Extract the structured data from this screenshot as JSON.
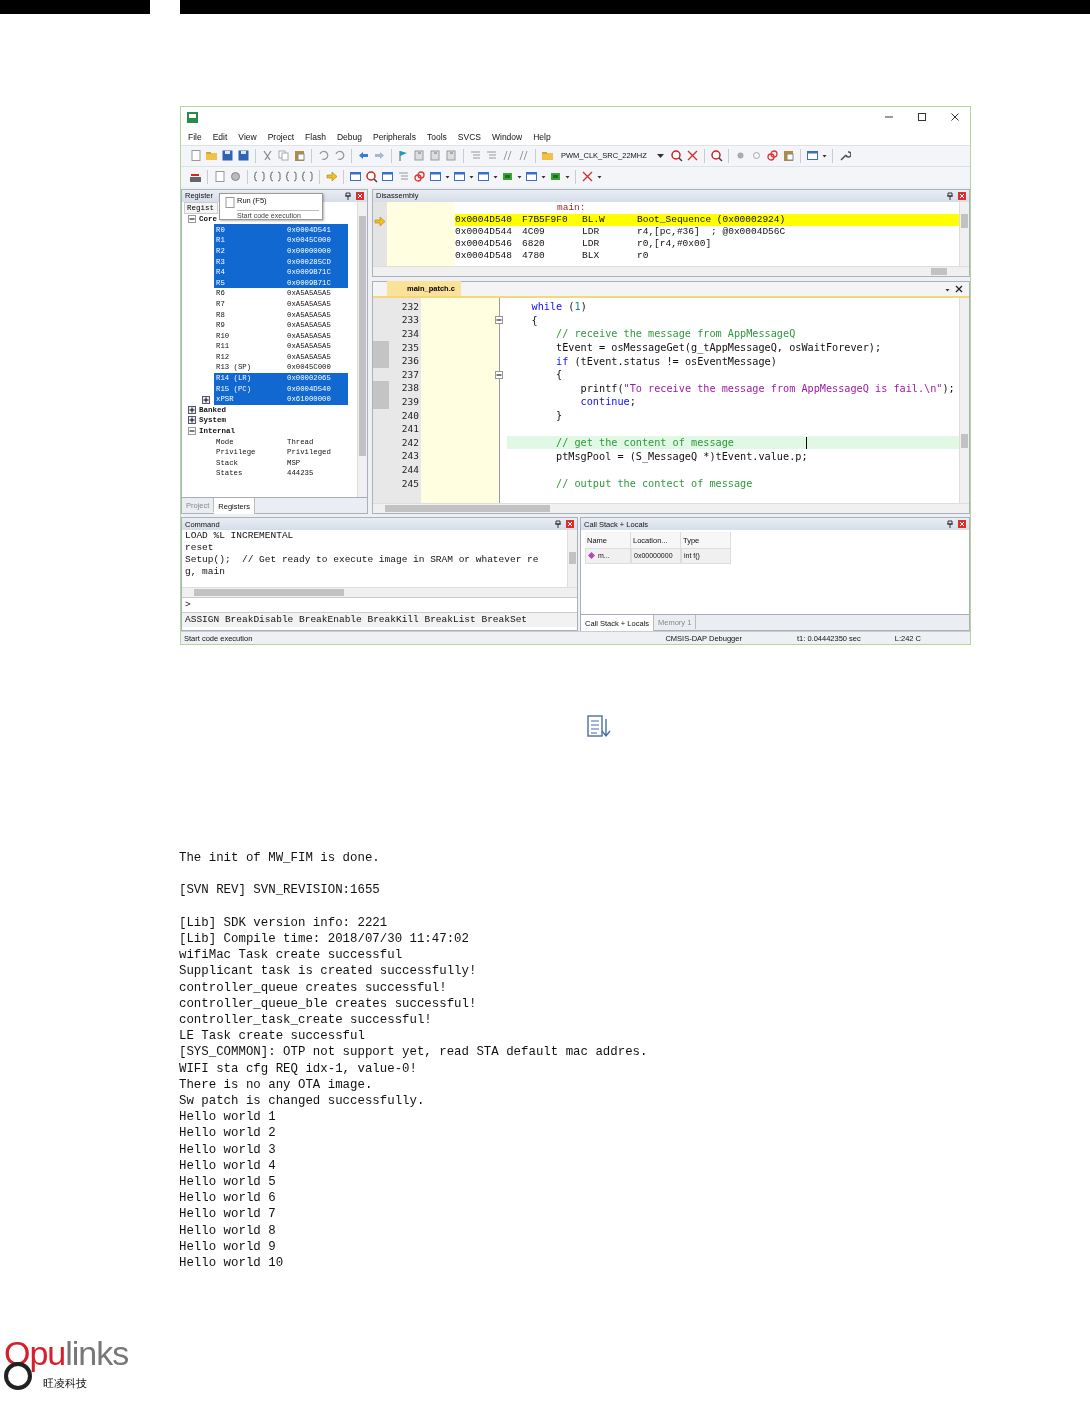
{
  "ide": {
    "menu": [
      "File",
      "Edit",
      "View",
      "Project",
      "Flash",
      "Debug",
      "Peripherals",
      "Tools",
      "SVCS",
      "Window",
      "Help"
    ],
    "toolbar": {
      "target": "PWM_CLK_SRC_22MHZ"
    },
    "registers": {
      "title": "Register",
      "tooltip": {
        "title": "Run (F5)",
        "hint": "Start code execution"
      },
      "column": "Regist",
      "tree": [
        {
          "label": "Core",
          "expanded": true,
          "children": [
            {
              "name": "R0",
              "value": "0x0004D541",
              "selected": true
            },
            {
              "name": "R1",
              "value": "0x0045C000",
              "selected": true
            },
            {
              "name": "R2",
              "value": "0x00000000",
              "selected": true
            },
            {
              "name": "R3",
              "value": "0x000285CD",
              "selected": true
            },
            {
              "name": "R4",
              "value": "0x0009B71C",
              "selected": true
            },
            {
              "name": "R5",
              "value": "0x0009B71C",
              "selected": true
            },
            {
              "name": "R6",
              "value": "0xA5A5A5A5",
              "selected": false
            },
            {
              "name": "R7",
              "value": "0xA5A5A5A5",
              "selected": false
            },
            {
              "name": "R8",
              "value": "0xA5A5A5A5",
              "selected": false
            },
            {
              "name": "R9",
              "value": "0xA5A5A5A5",
              "selected": false
            },
            {
              "name": "R10",
              "value": "0xA5A5A5A5",
              "selected": false
            },
            {
              "name": "R11",
              "value": "0xA5A5A5A5",
              "selected": false
            },
            {
              "name": "R12",
              "value": "0xA5A5A5A5",
              "selected": false
            },
            {
              "name": "R13 (SP)",
              "value": "0x0045C000",
              "selected": false
            },
            {
              "name": "R14 (LR)",
              "value": "0x00002065",
              "selected": true
            },
            {
              "name": "R15 (PC)",
              "value": "0x0004D540",
              "selected": true
            },
            {
              "name": "xPSR",
              "value": "0x61000000",
              "selected": true,
              "expanded": false
            }
          ]
        },
        {
          "label": "Banked",
          "expanded": false
        },
        {
          "label": "System",
          "expanded": false
        },
        {
          "label": "Internal",
          "expanded": true,
          "children": [
            {
              "name": "Mode",
              "value": "Thread",
              "selected": false
            },
            {
              "name": "Privilege",
              "value": "Privileged",
              "selected": false
            },
            {
              "name": "Stack",
              "value": "MSP",
              "selected": false
            },
            {
              "name": "States",
              "value": "444235",
              "selected": false
            }
          ]
        }
      ],
      "tabs": [
        {
          "label": "Project",
          "selected": false
        },
        {
          "label": "Registers",
          "selected": true
        }
      ]
    },
    "disassembly": {
      "title": "Disassembly",
      "label": "main:",
      "rows": [
        {
          "address": "0x0004D540",
          "opcode": "F7B5F9F0",
          "mnemonic": "BL.W",
          "operand": "Boot_Sequence (0x00002924)",
          "current": true
        },
        {
          "address": "0x0004D544",
          "opcode": "4C09",
          "mnemonic": "LDR",
          "operand": "r4,[pc,#36]  ; @0x0004D56C",
          "current": false
        },
        {
          "address": "0x0004D546",
          "opcode": "6820",
          "mnemonic": "LDR",
          "operand": "r0,[r4,#0x00]",
          "current": false
        },
        {
          "address": "0x0004D548",
          "opcode": "4780",
          "mnemonic": "BLX",
          "operand": "r0",
          "current": false
        }
      ]
    },
    "editor": {
      "tab": "main_patch.c",
      "lines": [
        {
          "number": "232",
          "segments": [
            {
              "kind": "keyword",
              "text": "    while"
            },
            {
              "kind": "plain",
              "text": " ("
            },
            {
              "kind": "number",
              "text": "1"
            },
            {
              "kind": "plain",
              "text": ")"
            }
          ]
        },
        {
          "number": "233",
          "fold": true,
          "segments": [
            {
              "kind": "plain",
              "text": "    {"
            }
          ]
        },
        {
          "number": "234",
          "segments": [
            {
              "kind": "comment",
              "text": "        // receive the message from AppMessageQ"
            }
          ]
        },
        {
          "number": "235",
          "marked": true,
          "segments": [
            {
              "kind": "plain",
              "text": "        tEvent = osMessageGet(g_tAppMessageQ, osWaitForever);"
            }
          ]
        },
        {
          "number": "236",
          "marked": true,
          "segments": [
            {
              "kind": "keyword",
              "text": "        if"
            },
            {
              "kind": "plain",
              "text": " (tEvent.status != osEventMessage)"
            }
          ]
        },
        {
          "number": "237",
          "fold": true,
          "segments": [
            {
              "kind": "plain",
              "text": "        {"
            }
          ]
        },
        {
          "number": "238",
          "marked": true,
          "segments": [
            {
              "kind": "plain",
              "text": "            printf("
            },
            {
              "kind": "string",
              "text": "\"To receive the message from AppMessageQ is fail.\\n\""
            },
            {
              "kind": "plain",
              "text": ");"
            }
          ]
        },
        {
          "number": "239",
          "marked": true,
          "segments": [
            {
              "kind": "keyword",
              "text": "            continue"
            },
            {
              "kind": "plain",
              "text": ";"
            }
          ]
        },
        {
          "number": "240",
          "segments": [
            {
              "kind": "plain",
              "text": "        }"
            }
          ]
        },
        {
          "number": "241"
        },
        {
          "number": "242",
          "highlighted": true,
          "segments": [
            {
              "kind": "comment",
              "text": "        // get the content of message"
            }
          ]
        },
        {
          "number": "243",
          "segments": [
            {
              "kind": "plain",
              "text": "        ptMsgPool = (S_MessageQ *)tEvent.value.p;"
            }
          ]
        },
        {
          "number": "244"
        },
        {
          "number": "245",
          "segments": [
            {
              "kind": "comment",
              "text": "        // output the contect of message"
            }
          ]
        }
      ]
    },
    "command": {
      "title": "Command",
      "lines": [
        "LOAD %L INCREMENTAL",
        "reset",
        "Setup();  // Get ready to execute image in SRAM or whatever re",
        "g, main"
      ],
      "prompt": ">",
      "hint": "ASSIGN BreakDisable BreakEnable BreakKill BreakList BreakSet"
    },
    "call_stack": {
      "title": "Call Stack + Locals",
      "columns": [
        "Name",
        "Location...",
        "Type"
      ],
      "rows": [
        [
          "m...",
          "0x00000000",
          "int f()"
        ]
      ],
      "tabs": [
        {
          "label": "Call Stack + Locals",
          "selected": true
        },
        {
          "label": "Memory 1",
          "selected": false
        }
      ]
    },
    "status_bar": [
      "Start code execution",
      "CMSIS-DAP Debugger",
      "t1: 0.04442350 sec",
      "L:242 C"
    ]
  },
  "console": [
    [
      "The init of MW_FIM is done."
    ],
    [
      "[SVN REV] SVN_REVISION:1655"
    ],
    [
      "[Lib] SDK version info: 2221",
      "[Lib] Compile time: 2018/07/30 11:47:02",
      "wifiMac Task create successful",
      "Supplicant task is created successfully!",
      "controller_queue creates successful!",
      "controller_queue_ble creates successful!",
      "controller_task_create successful!",
      "LE Task create successful",
      "[SYS_COMMON]: OTP not support yet, read STA default mac addres.",
      "WIFI sta cfg REQ idx-1, value-0!",
      "There is no any OTA image.",
      "Sw patch is changed successfully.",
      "Hello world 1",
      "Hello world 2",
      "Hello world 3",
      "Hello world 4",
      "Hello world 5",
      "Hello world 6",
      "Hello world 7",
      "Hello world 8",
      "Hello world 9",
      "Hello world 10"
    ]
  ],
  "logo": {
    "lead": "Opu",
    "rest": "links",
    "subtitle": "旺凌科技"
  }
}
